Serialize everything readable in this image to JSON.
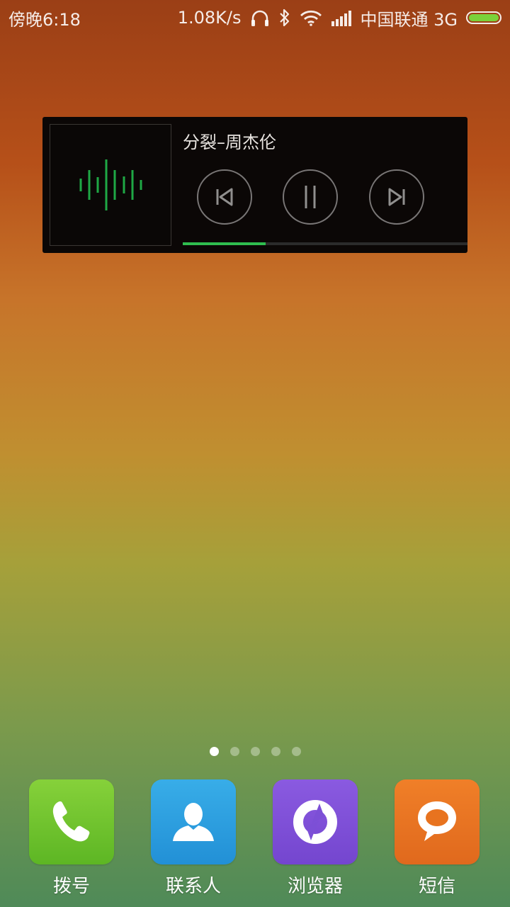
{
  "status_bar": {
    "time": "傍晚6:18",
    "net_speed": "1.08K/s",
    "carrier": "中国联通 3G",
    "icons": [
      "headphones-icon",
      "bluetooth-icon",
      "wifi-icon",
      "signal-icon",
      "battery-icon"
    ],
    "battery_color": "#7ad23a"
  },
  "music_widget": {
    "title": "分裂–周杰伦",
    "progress": 0.29,
    "accent": "#2fbd4f",
    "controls": [
      "previous-icon",
      "pause-icon",
      "next-icon"
    ]
  },
  "page_indicator": {
    "count": 5,
    "active_index": 0
  },
  "dock": {
    "apps": [
      {
        "label": "拨号",
        "icon": "phone-icon",
        "color": "#6bc22c"
      },
      {
        "label": "联系人",
        "icon": "contact-icon",
        "color": "#2d9ee0"
      },
      {
        "label": "浏览器",
        "icon": "browser-icon",
        "color": "#7f4ed8"
      },
      {
        "label": "短信",
        "icon": "message-icon",
        "color": "#ec7321"
      }
    ]
  }
}
